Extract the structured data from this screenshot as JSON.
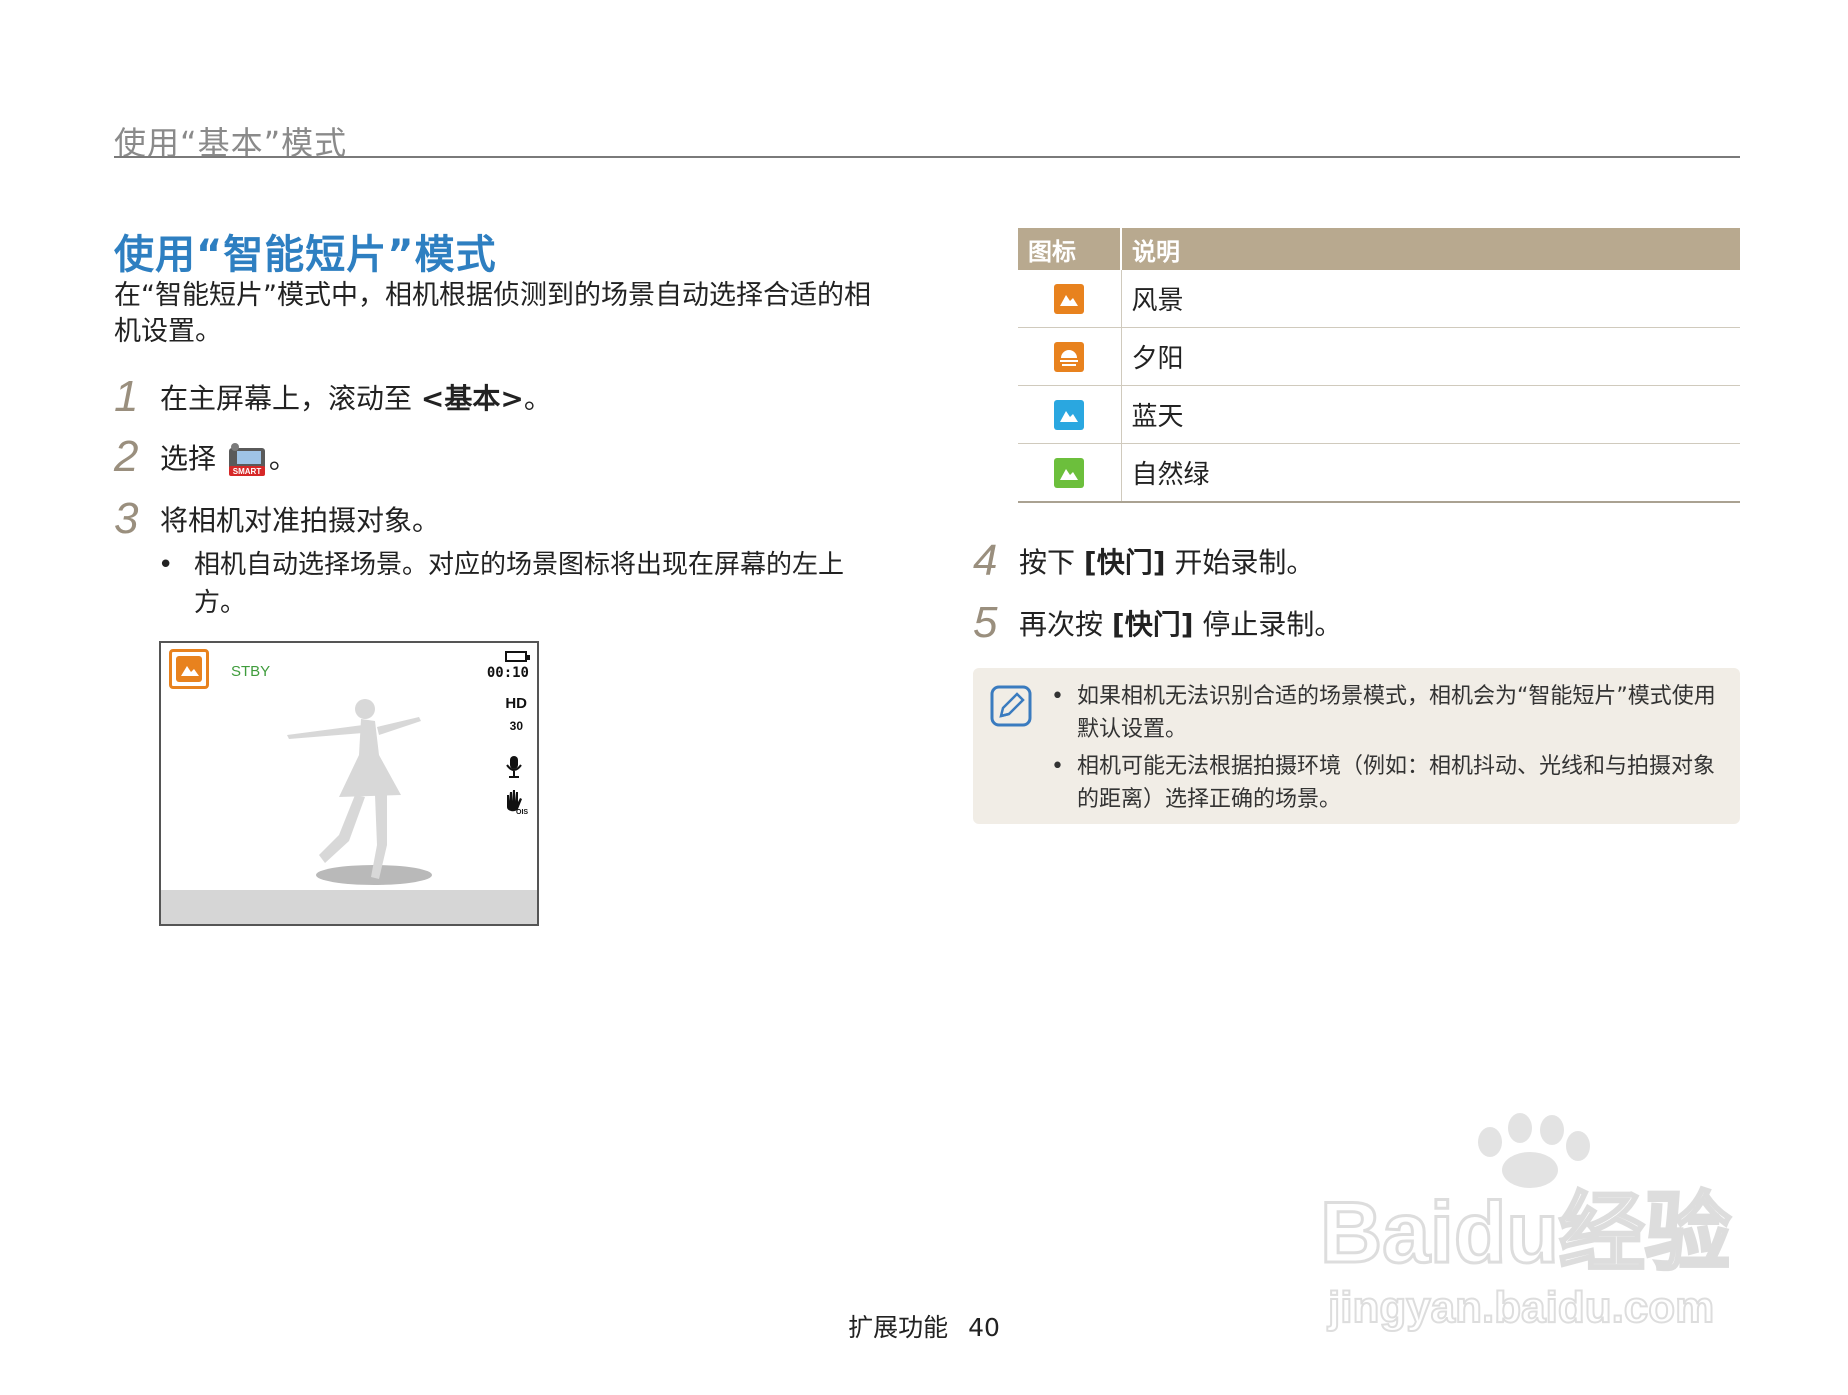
{
  "header": {
    "title": "使用“基本”模式"
  },
  "section": {
    "title": "使用“智能短片”模式",
    "intro": "在“智能短片”模式中，相机根据侦测到的场景自动选择合适的相机设置。"
  },
  "steps": [
    {
      "num": "1",
      "text": "在主屏幕上，滚动至 ",
      "bold": "<基本>",
      "tail": "。"
    },
    {
      "num": "2",
      "text": "选择 ",
      "tail": "。",
      "icon_label": "SMART"
    },
    {
      "num": "3",
      "text": "将相机对准拍摄对象。"
    },
    {
      "num": "4",
      "text": "按下 ",
      "bold": "[快门]",
      "tail": " 开始录制。"
    },
    {
      "num": "5",
      "text": "再次按 ",
      "bold": "[快门]",
      "tail": " 停止录制。"
    }
  ],
  "step3_bullet": "相机自动选择场景。对应的场景图标将出现在屏幕的左上方。",
  "preview": {
    "status": "STBY",
    "time": "00:10",
    "quality": "HD",
    "fps": "30"
  },
  "table": {
    "headers": [
      "图标",
      "说明"
    ],
    "rows": [
      {
        "icon": "landscape-icon",
        "color": "#e8821e",
        "label": "风景"
      },
      {
        "icon": "sunset-icon",
        "color": "#e8821e",
        "label": "夕阳"
      },
      {
        "icon": "blue-sky-icon",
        "color": "#2aa7e0",
        "label": "蓝天"
      },
      {
        "icon": "natural-green-icon",
        "color": "#6cbf3c",
        "label": "自然绿"
      }
    ]
  },
  "note": {
    "items": [
      "如果相机无法识别合适的场景模式，相机会为“智能短片”模式使用默认设置。",
      "相机可能无法根据拍摄环境（例如：相机抖动、光线和与拍摄对象的距离）选择正确的场景。"
    ]
  },
  "footer": {
    "section": "扩展功能",
    "page": "40"
  },
  "watermark": {
    "brand": "Baidu经验",
    "url": "jingyan.baidu.com"
  }
}
